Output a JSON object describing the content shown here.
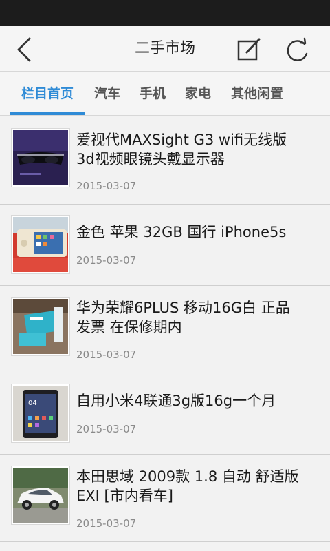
{
  "header": {
    "title": "二手市场",
    "icons": {
      "back": "chevron-left-icon",
      "edit": "compose-icon",
      "refresh": "refresh-icon"
    }
  },
  "tabs": [
    {
      "label": "栏目首页",
      "active": true
    },
    {
      "label": "汽车",
      "active": false
    },
    {
      "label": "手机",
      "active": false
    },
    {
      "label": "家电",
      "active": false
    },
    {
      "label": "其他闲置",
      "active": false
    }
  ],
  "colors": {
    "accent": "#2f8bd6",
    "background": "#f2f2f2",
    "header": "#f5f5f5",
    "statusbar": "#1c1c1c"
  },
  "items": [
    {
      "title_line1": "爱视代MAXSight G3 wifi无线版",
      "title_line2": "3d视频眼镜头戴显示器",
      "date": "2015-03-07",
      "thumb": "video-glasses-photo"
    },
    {
      "title_line1": "金色 苹果 32GB 国行 iPhone5s",
      "title_line2": "",
      "date": "2015-03-07",
      "thumb": "iphone-photo"
    },
    {
      "title_line1": "华为荣耀6PLUS 移动16G白 正品",
      "title_line2": "发票 在保修期内",
      "date": "2015-03-07",
      "thumb": "phone-box-photo"
    },
    {
      "title_line1": "自用小米4联通3g版16g一个月",
      "title_line2": "",
      "date": "2015-03-07",
      "thumb": "xiaomi-phone-photo"
    },
    {
      "title_line1": "本田思域 2009款 1.8 自动 舒适版",
      "title_line2": "EXI  [市内看车]",
      "date": "2015-03-07",
      "thumb": "white-car-photo"
    }
  ]
}
